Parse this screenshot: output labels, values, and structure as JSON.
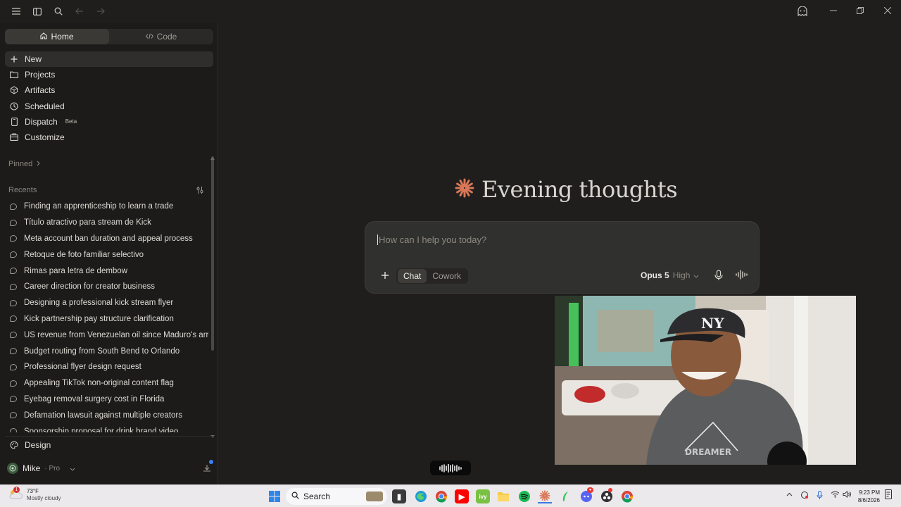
{
  "titlebar": {
    "menu_icon": "hamburger-icon",
    "sidebar_icon": "sidebar-toggle-icon",
    "search_icon": "search-icon",
    "back_icon": "arrow-left-icon",
    "forward_icon": "arrow-right-icon",
    "incognito_icon": "ghost-icon"
  },
  "sidebar": {
    "tabs": [
      {
        "label": "Home",
        "icon": "home-icon",
        "active": true
      },
      {
        "label": "Code",
        "icon": "code-icon",
        "active": false
      }
    ],
    "nav": [
      {
        "label": "New",
        "icon": "plus-icon"
      },
      {
        "label": "Projects",
        "icon": "folder-icon"
      },
      {
        "label": "Artifacts",
        "icon": "artifacts-icon"
      },
      {
        "label": "Scheduled",
        "icon": "clock-icon"
      },
      {
        "label": "Dispatch",
        "icon": "phone-icon",
        "badge": "Beta"
      },
      {
        "label": "Customize",
        "icon": "briefcase-icon"
      }
    ],
    "pinned_label": "Pinned",
    "recents_label": "Recents",
    "recents": [
      "Finding an apprenticeship to learn a trade",
      "Título atractivo para stream de Kick",
      "Meta account ban duration and appeal process",
      "Retoque de foto familiar selectivo",
      "Rimas para letra de dembow",
      "Career direction for creator business",
      "Designing a professional kick stream flyer",
      "Kick partnership pay structure clarification",
      "US revenue from Venezuelan oil since Maduro's arrest",
      "Budget routing from South Bend to Orlando",
      "Professional flyer design request",
      "Appealing TikTok non-original content flag",
      "Eyebag removal surgery cost in Florida",
      "Defamation lawsuit against multiple creators",
      "Sponsorship proposal for drink brand video"
    ],
    "design_label": "Design",
    "user": {
      "name": "Mike",
      "plan": "· Pro"
    }
  },
  "main": {
    "greeting": "Evening thoughts",
    "accent_color": "#d97757",
    "composer": {
      "placeholder": "How can I help you today?",
      "modes": [
        {
          "label": "Chat",
          "active": true
        },
        {
          "label": "Cowork",
          "active": false
        }
      ],
      "model": "Opus 5",
      "effort": "High"
    }
  },
  "taskbar": {
    "weather": {
      "temp": "73°F",
      "desc": "Mostly cloudy",
      "alert": "1"
    },
    "search_label": "Search",
    "time": "9:23 PM",
    "date": "8/6/2026"
  }
}
